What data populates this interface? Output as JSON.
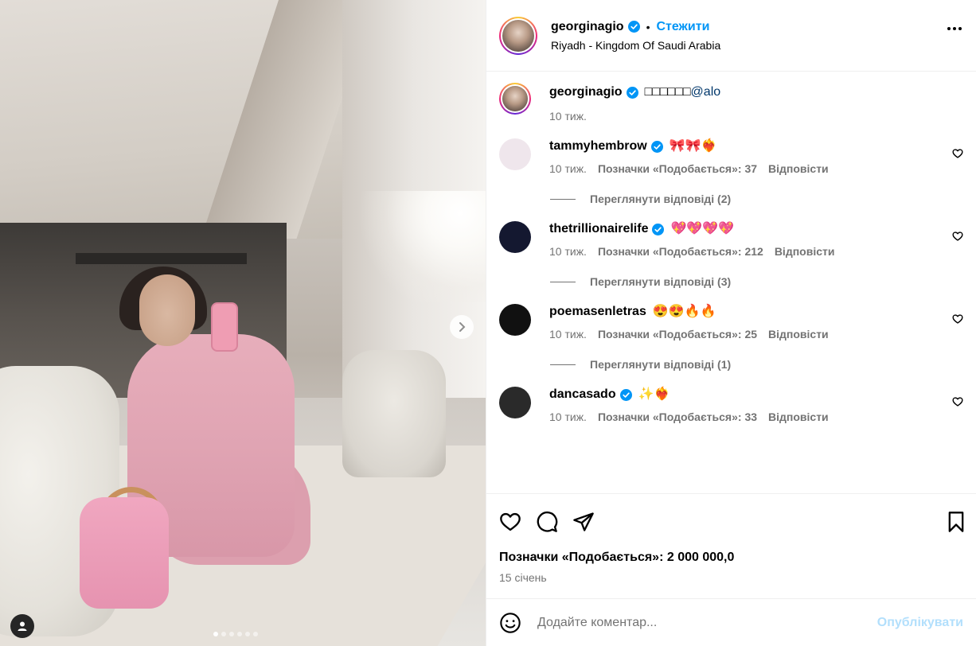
{
  "post": {
    "username": "georginagio",
    "follow_label": "Стежити",
    "separator": "•",
    "location": "Riyadh - Kingdom Of Saudi Arabia",
    "carousel_dots": 6,
    "carousel_active": 0
  },
  "caption": {
    "username": "georginagio",
    "text": "□□□□□□",
    "mention": "@alo",
    "time": "10 тиж."
  },
  "comments": [
    {
      "username": "tammyhembrow",
      "verified": true,
      "text": "🎀🎀❤️‍🔥",
      "time": "10 тиж.",
      "likes": "Позначки «Подобається»: 37",
      "reply_label": "Відповісти",
      "view_replies": "Переглянути відповіді (2)",
      "avatar_color": "#efe6ec"
    },
    {
      "username": "thetrillionairelife",
      "verified": true,
      "text": "💖💖💖💖",
      "time": "10 тиж.",
      "likes": "Позначки «Подобається»: 212",
      "reply_label": "Відповісти",
      "view_replies": "Переглянути відповіді (3)",
      "avatar_color": "#141830"
    },
    {
      "username": "poemasenletras",
      "verified": false,
      "text": "😍😍🔥🔥",
      "time": "10 тиж.",
      "likes": "Позначки «Подобається»: 25",
      "reply_label": "Відповісти",
      "view_replies": "Переглянути відповіді (1)",
      "avatar_color": "#111111"
    },
    {
      "username": "dancasado",
      "verified": true,
      "text": "✨❤️‍🔥",
      "time": "10 тиж.",
      "likes": "Позначки «Подобається»: 33",
      "reply_label": "Відповісти",
      "avatar_color": "#2a2a2a"
    }
  ],
  "stats": {
    "likes_total": "Позначки «Подобається»: 2 000 000,0",
    "date": "15 січень"
  },
  "composer": {
    "placeholder": "Додайте коментар...",
    "post_label": "Опублікувати"
  },
  "colors": {
    "accent": "#0095f6",
    "verified": "#0095f6",
    "muted": "#737373",
    "post_disabled": "#b2dffc"
  },
  "icons": {
    "verified": "verified-badge-icon",
    "more": "more-options-icon",
    "heart": "heart-icon",
    "comment": "comment-icon",
    "share": "share-icon",
    "bookmark": "bookmark-icon",
    "emoji": "emoji-icon",
    "next": "chevron-right-icon",
    "user": "user-icon"
  }
}
